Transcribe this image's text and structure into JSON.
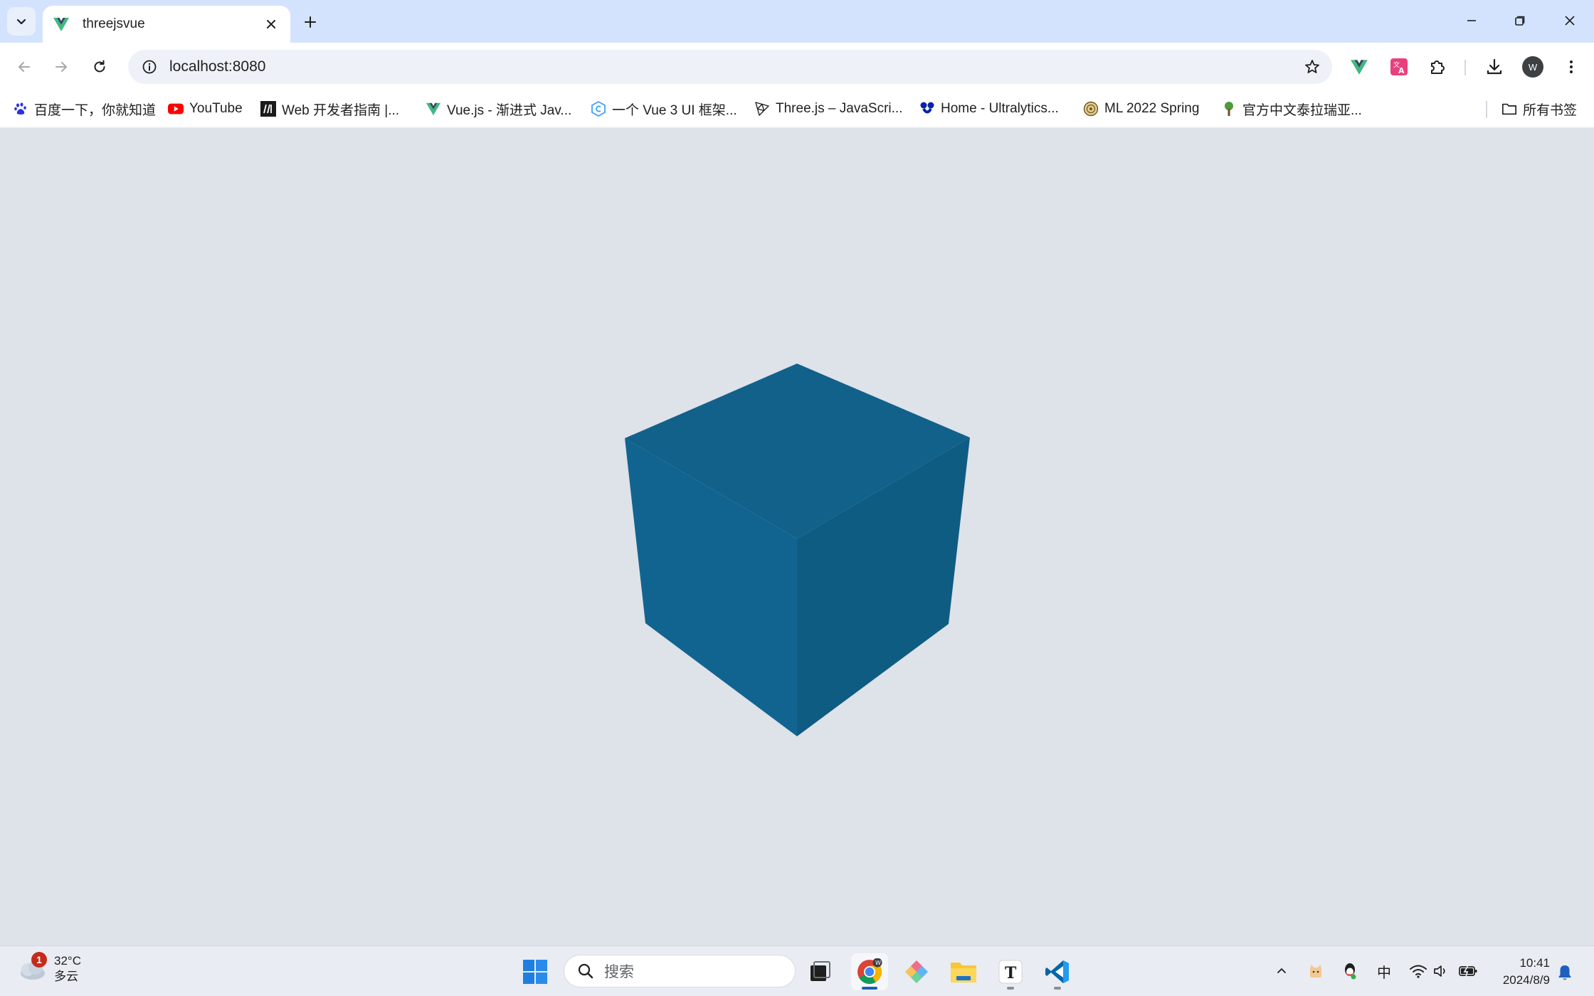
{
  "browser": {
    "tab": {
      "title": "threejsvue",
      "favicon": "vue-logo-icon"
    },
    "address": {
      "url": "localhost:8080"
    },
    "toolbar_icons": [
      "vue-devtools-icon",
      "translate-extension-icon",
      "extensions-puzzle-icon",
      "download-icon",
      "profile-avatar-icon",
      "more-menu-icon"
    ],
    "profile_initial": "W",
    "bookmarks": [
      {
        "label": "百度一下，你就知道",
        "icon": "baidu-paw-icon"
      },
      {
        "label": "YouTube",
        "icon": "youtube-icon"
      },
      {
        "label": "Web 开发者指南 |...",
        "icon": "mdn-icon"
      },
      {
        "label": "Vue.js - 渐进式 Jav...",
        "icon": "vue-logo-icon"
      },
      {
        "label": "一个 Vue 3 UI 框架...",
        "icon": "element-plus-icon"
      },
      {
        "label": "Three.js – JavaScri...",
        "icon": "threejs-icon"
      },
      {
        "label": "Home - Ultralytics...",
        "icon": "ultralytics-icon"
      },
      {
        "label": "ML 2022 Spring",
        "icon": "ntu-icon"
      },
      {
        "label": "官方中文泰拉瑞亚...",
        "icon": "terraria-tree-icon"
      }
    ],
    "all_bookmarks_label": "所有书签"
  },
  "scene": {
    "object": "cube",
    "background_color": "#dee2e9",
    "face_colors": {
      "top": "#11618a",
      "left": "#126490",
      "right": "#0f5c83"
    }
  },
  "taskbar": {
    "weather": {
      "temperature": "32°C",
      "condition": "多云",
      "badge": "1"
    },
    "search_placeholder": "搜索",
    "apps": [
      "windows-start-icon",
      "task-view-icon",
      "chrome-icon",
      "copilot-icon",
      "file-explorer-icon",
      "typora-icon",
      "vscode-icon"
    ],
    "tray": {
      "input_method": "中"
    },
    "clock": {
      "time": "10:41",
      "date": "2024/8/9"
    }
  }
}
